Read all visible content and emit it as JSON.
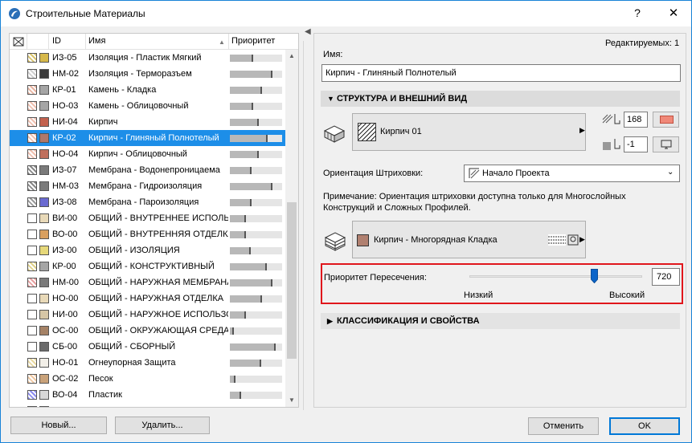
{
  "window": {
    "title": "Строительные Материалы",
    "help_label": "?",
    "close_label": "✕"
  },
  "list": {
    "header": {
      "id": "ID",
      "name": "Имя",
      "priority": "Приоритет"
    },
    "rows": [
      {
        "id": "ИЗ-05",
        "name": "Изоляция - Пластик Мягкий",
        "color": "#d6b84a",
        "hatch_color": "#d9c46c",
        "priority": 0.45,
        "selected": false
      },
      {
        "id": "НМ-02",
        "name": "Изоляция - Терморазъем",
        "color": "#3b3b3b",
        "hatch_color": "#cfcfcf",
        "priority": 0.82,
        "selected": false
      },
      {
        "id": "КР-01",
        "name": "Камень - Кладка",
        "color": "#a5a5a5",
        "hatch_color": "#e8b3a0",
        "priority": 0.62,
        "selected": false
      },
      {
        "id": "НО-03",
        "name": "Камень - Облицовочный",
        "color": "#a5a5a5",
        "hatch_color": "#f0c0b0",
        "priority": 0.45,
        "selected": false
      },
      {
        "id": "НИ-04",
        "name": "Кирпич",
        "color": "#c2614e",
        "hatch_color": "#f0c0b0",
        "priority": 0.55,
        "selected": false
      },
      {
        "id": "КР-02",
        "name": "Кирпич - Глиняный Полнотелый",
        "color": "#b0786a",
        "hatch_color": "#f0c0b0",
        "priority": 0.72,
        "selected": true
      },
      {
        "id": "НО-04",
        "name": "Кирпич - Облицовочный",
        "color": "#c0705d",
        "hatch_color": "#f0c0b0",
        "priority": 0.55,
        "selected": false
      },
      {
        "id": "ИЗ-07",
        "name": "Мембрана - Водонепроницаема",
        "color": "#7a7a7a",
        "hatch_color": "#888888",
        "priority": 0.42,
        "selected": false
      },
      {
        "id": "НМ-03",
        "name": "Мембрана - Гидроизоляция",
        "color": "#7a7a7a",
        "hatch_color": "#888888",
        "priority": 0.82,
        "selected": false
      },
      {
        "id": "ИЗ-08",
        "name": "Мембрана - Пароизоляция",
        "color": "#6a6ad0",
        "hatch_color": "#9a9a9a",
        "priority": 0.42,
        "selected": false
      },
      {
        "id": "ВИ-00",
        "name": "ОБЩИЙ - ВНУТРЕННЕЕ ИСПОЛЬЗО",
        "color": "#e8d9b8",
        "hatch_color": "#ffffff",
        "priority": 0.3,
        "selected": false
      },
      {
        "id": "ВО-00",
        "name": "ОБЩИЙ - ВНУТРЕННЯЯ ОТДЕЛКА",
        "color": "#d9a060",
        "hatch_color": "#ffffff",
        "priority": 0.3,
        "selected": false
      },
      {
        "id": "ИЗ-00",
        "name": "ОБЩИЙ - ИЗОЛЯЦИЯ",
        "color": "#e6d87a",
        "hatch_color": "#ffffff",
        "priority": 0.4,
        "selected": false
      },
      {
        "id": "КР-00",
        "name": "ОБЩИЙ - КОНСТРУКТИВНЫЙ",
        "color": "#a5a5a5",
        "hatch_color": "#e0d28a",
        "priority": 0.7,
        "selected": false
      },
      {
        "id": "НМ-00",
        "name": "ОБЩИЙ - НАРУЖНАЯ МЕМБРАНА",
        "color": "#7a7a7a",
        "hatch_color": "#e8a0a0",
        "priority": 0.82,
        "selected": false
      },
      {
        "id": "НО-00",
        "name": "ОБЩИЙ - НАРУЖНАЯ ОТДЕЛКА",
        "color": "#e8d9b8",
        "hatch_color": "#ffffff",
        "priority": 0.62,
        "selected": false
      },
      {
        "id": "НИ-00",
        "name": "ОБЩИЙ - НАРУЖНОЕ ИСПОЛЬЗО",
        "color": "#d6c6a6",
        "hatch_color": "#ffffff",
        "priority": 0.3,
        "selected": false
      },
      {
        "id": "ОС-00",
        "name": "ОБЩИЙ - ОКРУЖАЮЩАЯ СРЕДА",
        "color": "#a58266",
        "hatch_color": "#ffffff",
        "priority": 0.08,
        "selected": false
      },
      {
        "id": "СБ-00",
        "name": "ОБЩИЙ - СБОРНЫЙ",
        "color": "#6a6a6a",
        "hatch_color": "#ffffff",
        "priority": 0.88,
        "selected": false
      },
      {
        "id": "НО-01",
        "name": "Огнеупорная Защита",
        "color": "#f2efe8",
        "hatch_color": "#e9d9a0",
        "priority": 0.6,
        "selected": false
      },
      {
        "id": "ОС-02",
        "name": "Песок",
        "color": "#c9a27a",
        "hatch_color": "#efc7a0",
        "priority": 0.1,
        "selected": false
      },
      {
        "id": "ВО-04",
        "name": "Пластик",
        "color": "#d8d8d8",
        "hatch_color": "#8c8cf0",
        "priority": 0.22,
        "selected": false
      },
      {
        "id": "",
        "name": "",
        "color": "#d8d8d8",
        "hatch_color": "#ffffff",
        "priority": 0.25,
        "selected": false
      }
    ]
  },
  "buttons": {
    "new": "Новый...",
    "delete": "Удалить...",
    "cancel": "Отменить",
    "ok": "OK"
  },
  "right": {
    "editable_label": "Редактируемых: 1",
    "name_label": "Имя:",
    "name_value": "Кирпич - Глиняный Полнотелый",
    "section_structure": "СТРУКТУРА И ВНЕШНИЙ ВИД",
    "hatch_name": "Кирпич 01",
    "pen_value": "168",
    "bg_pen_value": "-1",
    "orientation_label": "Ориентация Штриховки:",
    "orientation_value": "Начало Проекта",
    "note_text": "Примечание: Ориентация штриховки доступна только для Многослойных Конструкций и Сложных Профилей.",
    "surface_name": "Кирпич - Многорядная Кладка",
    "surface_color": "#b08070",
    "priority_label": "Приоритет Пересечения:",
    "priority_value": "720",
    "priority_level": 0.72,
    "low_label": "Низкий",
    "high_label": "Высокий",
    "section_classification": "КЛАССИФИКАЦИЯ И СВОЙСТВА"
  },
  "colors": {
    "selection": "#1d8ee8",
    "highlight_red": "#e0161c",
    "pen_swatch": "#f08878"
  }
}
